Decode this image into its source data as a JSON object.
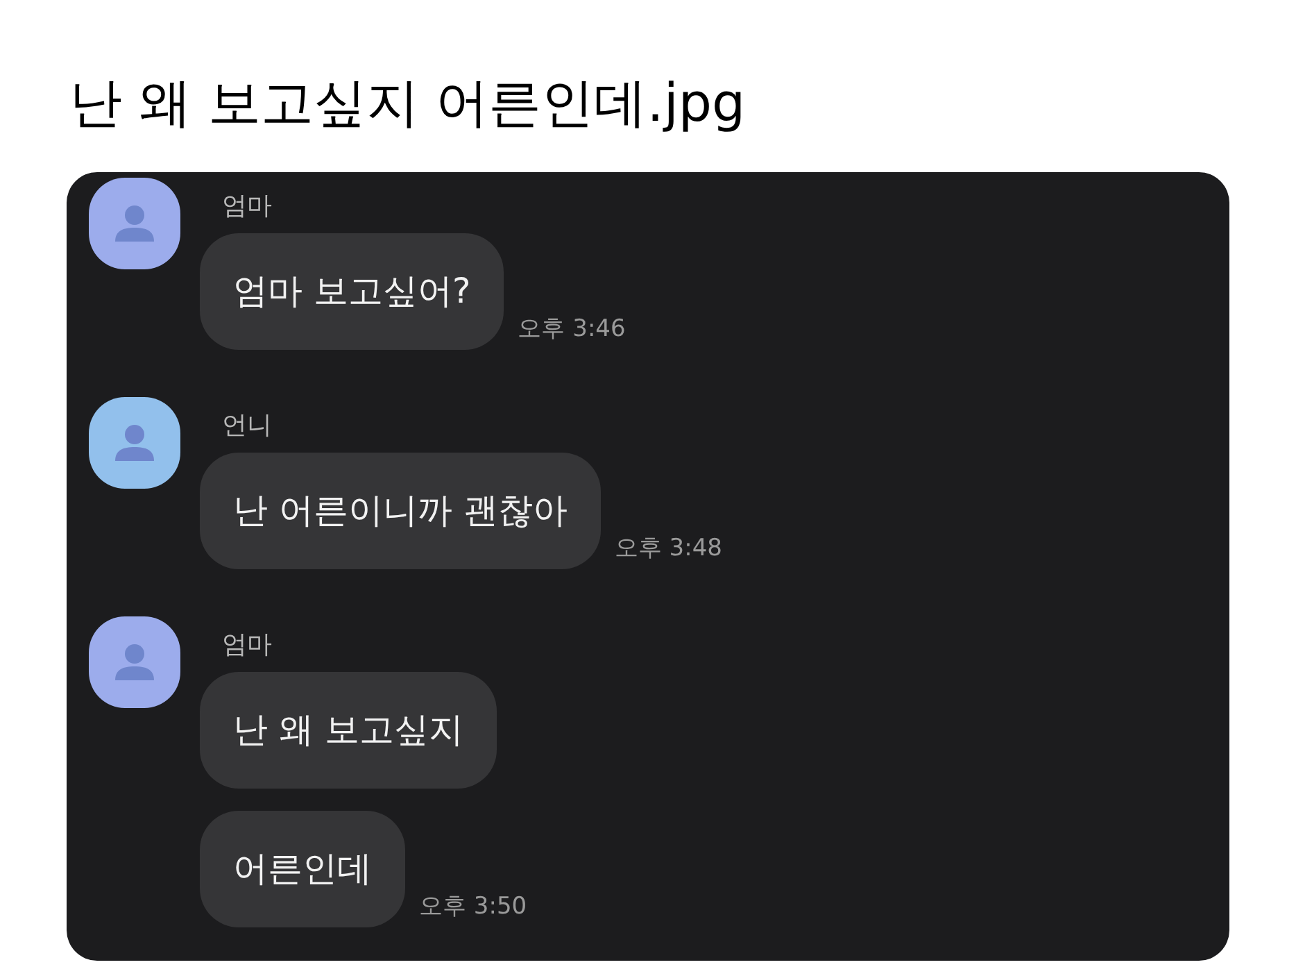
{
  "post_title": "난 왜 보고싶지 어른인데.jpg",
  "chat": [
    {
      "sender": "엄마",
      "color": "#9cacec",
      "messages": [
        {
          "text": "엄마 보고싶어?",
          "time": "오후 3:46"
        }
      ]
    },
    {
      "sender": "언니",
      "color": "#92c0ec",
      "messages": [
        {
          "text": "난 어른이니까 괜찮아",
          "time": "오후 3:48"
        }
      ]
    },
    {
      "sender": "엄마",
      "color": "#9cacec",
      "messages": [
        {
          "text": "난 왜 보고싶지"
        },
        {
          "text": "어른인데",
          "time": "오후 3:50"
        }
      ]
    }
  ]
}
